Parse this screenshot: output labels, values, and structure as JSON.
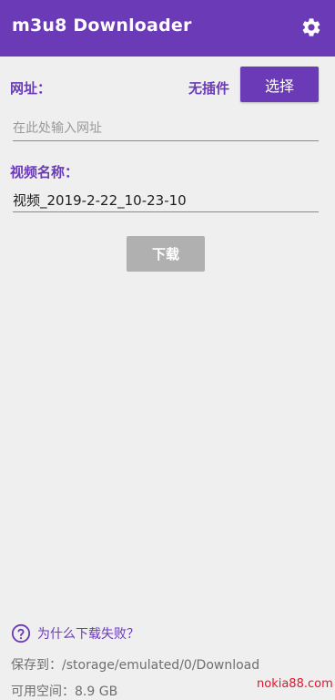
{
  "appbar": {
    "title": "m3u8 Downloader",
    "settings_icon": "gear-icon",
    "background": "#6a3ab7"
  },
  "url_section": {
    "label": "网址：",
    "plugin_status": "无插件",
    "select_button": "选择",
    "input_placeholder": "在此处输入网址",
    "input_value": ""
  },
  "name_section": {
    "label": "视频名称：",
    "input_value": "视频_2019-2-22_10-23-10"
  },
  "download_button": "下载",
  "footer": {
    "help_icon": "question-circle-icon",
    "help_text": "为什么下载失败？",
    "save_to": "保存到：/storage/emulated/0/Download",
    "available_space": "可用空间：8.9 GB"
  },
  "watermark": "nokia88.com",
  "colors": {
    "accent": "#6a3ab7",
    "disabled_button": "#b0b0b0",
    "watermark": "#e8132b"
  }
}
